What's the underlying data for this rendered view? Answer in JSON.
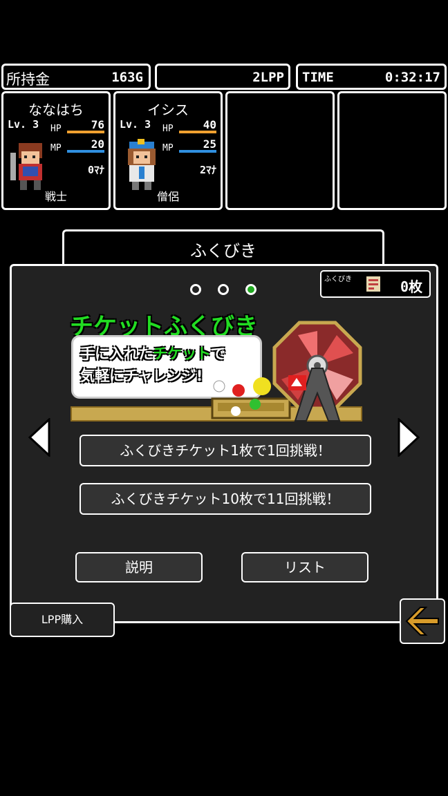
{
  "status": {
    "gold_label": "所持金",
    "gold_value": "163G",
    "lpp_value": "2LPP",
    "time_label": "TIME",
    "time_value": "0:32:17"
  },
  "party": [
    {
      "name": "ななはち",
      "lv": "Lv. 3",
      "hp": "76",
      "mp": "20",
      "mana": "0ﾏﾅ",
      "job": "戦士"
    },
    {
      "name": "イシス",
      "lv": "Lv. 3",
      "hp": "40",
      "mp": "25",
      "mana": "2ﾏﾅ",
      "job": "僧侶"
    }
  ],
  "labels": {
    "hp": "HP",
    "mp": "MP"
  },
  "fukubiki": {
    "title": "ふくびき",
    "ticket_label": "ふくびき",
    "ticket_count": "0枚",
    "banner_title": "チケットふくびき",
    "banner_line1_pre": "手に入れた",
    "banner_line1_hl": "チケット",
    "banner_line1_post": "で",
    "banner_line2": "気軽にチャレンジ!",
    "btn_single": "ふくびきチケット1枚で1回挑戦！",
    "btn_multi": "ふくびきチケット10枚で11回挑戦！",
    "btn_help": "説明",
    "btn_list": "リスト",
    "btn_buy": "LPP購入"
  },
  "colors": {
    "hp_bar": "#f0a030",
    "mp_bar": "#3090e0",
    "accent_green": "#22dd22",
    "back_arrow": "#d79b2a"
  }
}
